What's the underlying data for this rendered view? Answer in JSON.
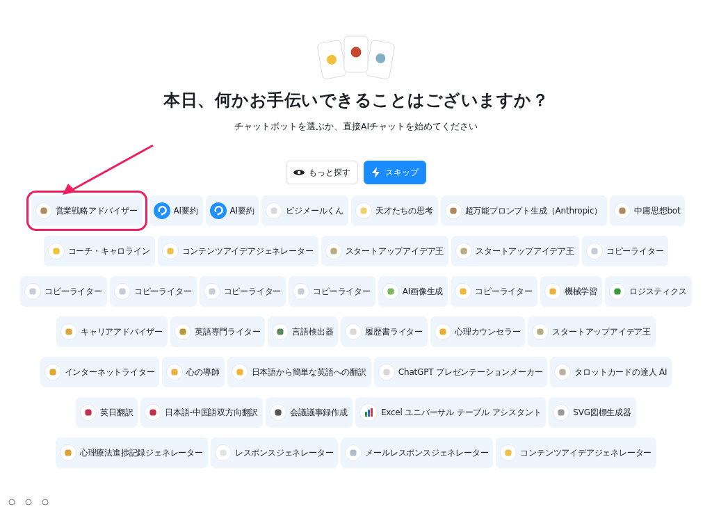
{
  "hero": {
    "title": "本日、何かお手伝いできることはございますか？",
    "subtitle": "チャットボットを選ぶか、直接AIチャットを始めてください"
  },
  "actions": [
    {
      "label": "もっと探す",
      "kind": "outline"
    },
    {
      "label": "スキップ",
      "kind": "primary"
    }
  ],
  "rows": [
    [
      {
        "label": "営業戦略アドバイザー",
        "kind": "emoji",
        "color": "#b08a5e",
        "highlighted": true
      },
      {
        "label": "AI要約",
        "kind": "logo",
        "highlighted": false
      },
      {
        "label": "AI要約",
        "kind": "logo",
        "highlighted": false
      },
      {
        "label": "ビジメールくん",
        "kind": "emoji",
        "color": "#d8d8dc",
        "highlighted": false
      },
      {
        "label": "天才たちの思考",
        "kind": "emoji",
        "color": "#f2d36b",
        "highlighted": false
      },
      {
        "label": "超万能プロンプト生成（Anthropic）",
        "kind": "emoji",
        "color": "#b08a5e",
        "highlighted": false
      },
      {
        "label": "中庸思想bot",
        "kind": "emoji",
        "color": "#b08a5e",
        "highlighted": false
      }
    ],
    [
      {
        "label": "コーチ・キャロライン",
        "kind": "emoji",
        "color": "#f2c23a",
        "highlighted": false
      },
      {
        "label": "コンテンツアイデアジェネレーター",
        "kind": "emoji",
        "color": "#e8c24a",
        "highlighted": false
      },
      {
        "label": "スタートアップアイデア王",
        "kind": "emoji",
        "color": "#b8ad80",
        "highlighted": false
      },
      {
        "label": "スタートアップアイデア王",
        "kind": "emoji",
        "color": "#b8ad80",
        "highlighted": false
      },
      {
        "label": "コピーライター",
        "kind": "emoji",
        "color": "#c8ccd2",
        "highlighted": false
      }
    ],
    [
      {
        "label": "コピーライター",
        "kind": "emoji",
        "color": "#c8ccd2",
        "highlighted": false
      },
      {
        "label": "コピーライター",
        "kind": "emoji",
        "color": "#c8ccd2",
        "highlighted": false
      },
      {
        "label": "コピーライター",
        "kind": "emoji",
        "color": "#c8ccd2",
        "highlighted": false
      },
      {
        "label": "コピーライター",
        "kind": "emoji",
        "color": "#c8ccd2",
        "highlighted": false
      },
      {
        "label": "AI画像生成",
        "kind": "emoji",
        "color": "#7bb85a",
        "highlighted": false
      },
      {
        "label": "コピーライター",
        "kind": "emoji",
        "color": "#f0b53a",
        "highlighted": false
      },
      {
        "label": "機械学習",
        "kind": "emoji",
        "color": "#e9b23a",
        "highlighted": false
      },
      {
        "label": "ロジスティクス",
        "kind": "emoji",
        "color": "#3a9a3a",
        "highlighted": false
      }
    ],
    [
      {
        "label": "キャリアアドバイザー",
        "kind": "emoji",
        "color": "#d9a640",
        "highlighted": false
      },
      {
        "label": "英語専門ライター",
        "kind": "emoji",
        "color": "#b99a3a",
        "highlighted": false
      },
      {
        "label": "言語検出器",
        "kind": "emoji",
        "color": "#5a8a5a",
        "highlighted": false
      },
      {
        "label": "履歴書ライター",
        "kind": "emoji",
        "color": "#d8d8d8",
        "highlighted": false
      },
      {
        "label": "心理カウンセラー",
        "kind": "emoji",
        "color": "#e8b030",
        "highlighted": false
      },
      {
        "label": "スタートアップアイデア王",
        "kind": "emoji",
        "color": "#b8ad80",
        "highlighted": false
      }
    ],
    [
      {
        "label": "インターネットライター",
        "kind": "emoji",
        "color": "#e0a830",
        "highlighted": false
      },
      {
        "label": "心の導師",
        "kind": "emoji",
        "color": "#e8b040",
        "highlighted": false
      },
      {
        "label": "日本語から簡単な英語への翻訳",
        "kind": "emoji",
        "color": "#f0b53a",
        "highlighted": false
      },
      {
        "label": "ChatGPT プレゼンテーションメーカー",
        "kind": "emoji",
        "color": "#d8d8d8",
        "highlighted": false
      },
      {
        "label": "タロットカードの達人 AI",
        "kind": "emoji",
        "color": "#b8b0a0",
        "highlighted": false
      }
    ],
    [
      {
        "label": "英日翻訳",
        "kind": "emoji",
        "color": "#c0304a",
        "highlighted": false
      },
      {
        "label": "日本語-中国語双方向翻訳",
        "kind": "emoji",
        "color": "#c0304a",
        "highlighted": false
      },
      {
        "label": "会議議事録作成",
        "kind": "emoji",
        "color": "#555555",
        "highlighted": false
      },
      {
        "label": "Excel ユニバーサル テーブル アシスタント",
        "kind": "chart",
        "highlighted": false
      },
      {
        "label": "SVG図標生成器",
        "kind": "emoji",
        "color": "#9a9a9a",
        "highlighted": false
      }
    ],
    [
      {
        "label": "心理療法進捗記録ジェネレーター",
        "kind": "emoji",
        "color": "#e0a030",
        "highlighted": false
      },
      {
        "label": "レスポンスジェネレーター",
        "kind": "emoji",
        "color": "#e4e4e4",
        "highlighted": false
      },
      {
        "label": "メールレスポンスジェネレーター",
        "kind": "emoji",
        "color": "#b0bccc",
        "highlighted": false
      },
      {
        "label": "コンテンツアイデアジェネレーター",
        "kind": "emoji",
        "color": "#e8c24a",
        "highlighted": false
      }
    ]
  ]
}
